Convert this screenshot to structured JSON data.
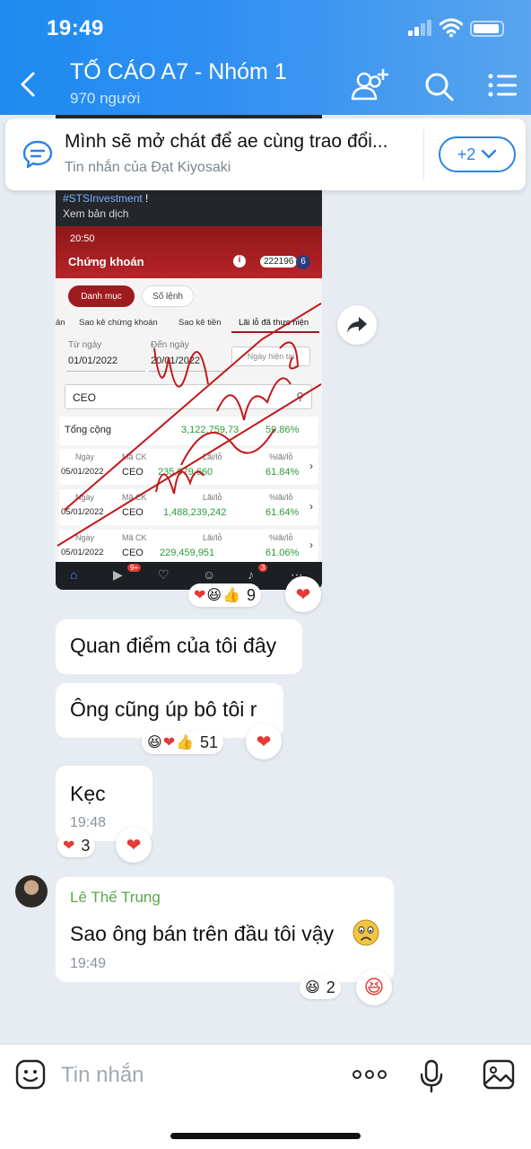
{
  "status_bar": {
    "time": "19:49"
  },
  "header": {
    "title": "TỐ CÁO A7 - Nhóm 1",
    "members": "970 người",
    "icons": [
      "back-icon",
      "add-member-icon",
      "search-icon",
      "menu-icon"
    ]
  },
  "pinned": {
    "text": "Mình sẽ mở chát để ae cùng trao đổi...",
    "sub": "Tin nhắn của Đạt Kiyosaki",
    "more": "+2"
  },
  "screenshot": {
    "hashtag": "#STSInvestment",
    "hashtag_suffix": " !",
    "translate": "Xem bản dịch",
    "time": "20:50",
    "section": "Chứng khoán",
    "account": "222196",
    "account_num": "6",
    "seg_active": "Danh mục",
    "seg_other": "Số lệnh",
    "tabs": [
      "ản",
      "Sao kê chứng khoán",
      "Sao kê tiền",
      "Lãi lỗ đã thực hiện"
    ],
    "from_label": "Từ ngày",
    "from_value": "01/01/2022",
    "to_label": "Đến ngày",
    "to_value": "20/01/2022",
    "btn": "Ngày hiện tại",
    "search": "CEO",
    "total_label": "Tổng cộng",
    "total_value": "3,122,759,73",
    "total_pct": "59.86%",
    "col_date": "Ngày",
    "col_code": "Mã CK",
    "col_pl": "Lãi/lỗ",
    "col_pct": "%lãi/lỗ",
    "rows": [
      {
        "date": "05/01/2022",
        "code": "CEO",
        "pl": "235,079,660",
        "pct": "61.84%"
      },
      {
        "date": "05/01/2022",
        "code": "CEO",
        "pl": "1,488,239,242",
        "pct": "61.64%"
      },
      {
        "date": "05/01/2022",
        "code": "CEO",
        "pl": "229,459,951",
        "pct": "61.06%"
      }
    ],
    "nav_badge1": "9+",
    "nav_badge2": "3",
    "reactions_count": "9"
  },
  "messages": {
    "m1": "Quan điểm của tôi đây",
    "m2": "Ông cũng úp bô tôi r",
    "m2_react_count": "51",
    "m3": "Kẹc",
    "m3_time": "19:48",
    "m3_react_count": "3",
    "m4_sender": "Lê Thế Trung",
    "m4": "Sao ông bán trên đầu tôi vậy",
    "m4_time": "19:49",
    "m4_react_count": "2"
  },
  "input": {
    "placeholder": "Tin nhắn"
  },
  "colors": {
    "header": "#1e8bf0",
    "accent": "#2b82e6",
    "sender": "#5aa84a",
    "heart": "#e53935"
  }
}
